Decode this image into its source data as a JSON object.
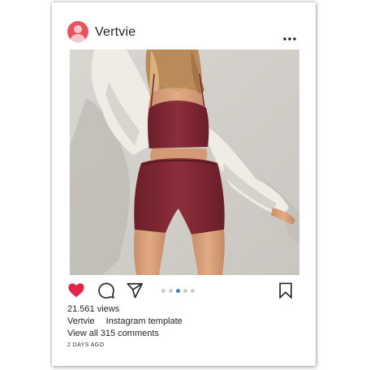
{
  "post": {
    "username": "Vertvie",
    "views": "21.561 views",
    "caption_user": "Vertvie",
    "caption_text": "Instagram template",
    "comments_link": "View all 315 comments",
    "timestamp": "2 DAYS AGO"
  },
  "carousel": {
    "count": 5,
    "active_index": 2
  },
  "icons": {
    "avatar": "user-avatar-icon",
    "more": "more-dots-icon",
    "like": "heart-icon",
    "comment": "comment-bubble-icon",
    "share": "paper-plane-icon",
    "save": "bookmark-icon"
  },
  "colors": {
    "like": "#e0244b",
    "avatar_bg": "#e8535f",
    "active_dot": "#3f7fd8",
    "inactive_dot": "#c9ced6"
  }
}
